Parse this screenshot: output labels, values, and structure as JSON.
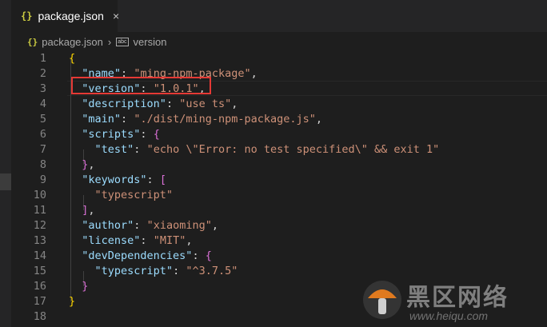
{
  "tab": {
    "icon": "json-braces-icon",
    "icon_text": "{}",
    "title": "package.json",
    "close": "×"
  },
  "breadcrumb": {
    "file_icon_text": "{}",
    "file": "package.json",
    "separator": "›",
    "symbol_icon_text": "abc",
    "symbol": "version"
  },
  "editor": {
    "line_numbers": [
      "1",
      "2",
      "3",
      "4",
      "5",
      "6",
      "7",
      "8",
      "9",
      "10",
      "11",
      "12",
      "13",
      "14",
      "15",
      "16",
      "17",
      "18"
    ],
    "tokens": {
      "name_k": "\"name\"",
      "name_v": "\"ming-npm-package\"",
      "version_k": "\"version\"",
      "version_v": "\"1.0.1\"",
      "description_k": "\"description\"",
      "description_v": "\"use ts\"",
      "main_k": "\"main\"",
      "main_v": "\"./dist/ming-npm-package.js\"",
      "scripts_k": "\"scripts\"",
      "test_k": "\"test\"",
      "test_v": "\"echo \\\"Error: no test specified\\\" && exit 1\"",
      "keywords_k": "\"keywords\"",
      "typescript_item": "\"typescript\"",
      "author_k": "\"author\"",
      "author_v": "\"xiaoming\"",
      "license_k": "\"license\"",
      "license_v": "\"MIT\"",
      "devdeps_k": "\"devDependencies\"",
      "ts_k": "\"typescript\"",
      "ts_v": "\"^3.7.5\""
    }
  },
  "watermark": {
    "chinese": "黑区网络",
    "url": "www.heiqu.com"
  },
  "colors": {
    "key": "#9cdcfe",
    "string": "#ce9178",
    "highlight_box": "#e53935",
    "background": "#1e1e1e"
  }
}
